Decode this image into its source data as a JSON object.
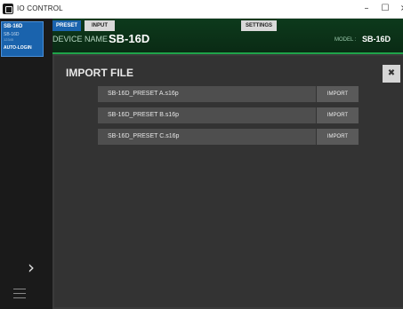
{
  "window": {
    "title": "IO CONTROL",
    "minimize": "–",
    "maximize": "☐",
    "close": "×"
  },
  "sidebar": {
    "unit": {
      "name": "SB-16D",
      "model": "SB-16D",
      "sub": "12345",
      "login": "AUTO-LOGIN"
    },
    "expand_icon": "chevron-right-icon",
    "menu_icon": "hamburger-icon"
  },
  "header": {
    "tabs": [
      {
        "label": "PRESET",
        "active": true
      },
      {
        "label": "INPUT",
        "active": false
      },
      {
        "label": "SETTINGS",
        "active": false
      }
    ],
    "device_label": "DEVICE NAME :",
    "device_name": "SB-16D",
    "model_label": "MODEL :",
    "model_name": "SB-16D"
  },
  "dialog": {
    "title": "IMPORT FILE",
    "close_icon": "close-icon",
    "files": [
      {
        "name": "SB-16D_PRESET A.s16p",
        "action": "IMPORT"
      },
      {
        "name": "SB-16D_PRESET B.s16p",
        "action": "IMPORT"
      },
      {
        "name": "SB-16D_PRESET C.s16p",
        "action": "IMPORT"
      }
    ]
  },
  "colors": {
    "accent": "#1a63ad",
    "header_green": "#1fa44a",
    "panel": "#333333"
  }
}
